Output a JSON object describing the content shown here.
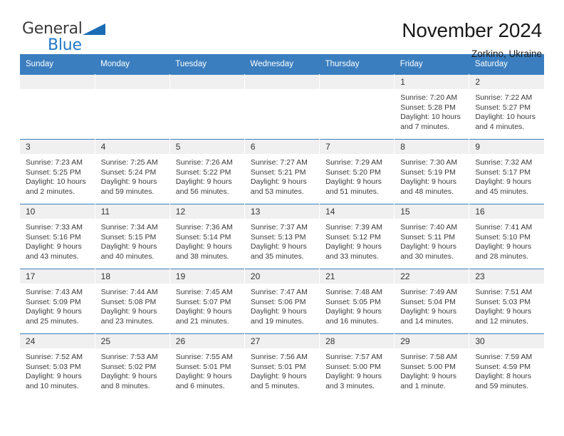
{
  "brand": {
    "name_part1": "General",
    "name_part2": "Blue",
    "triangle_color": "#1b6cb5",
    "blue": "#2079c8"
  },
  "header": {
    "title": "November 2024",
    "subtitle": "Zorkino, Ukraine"
  },
  "theme": {
    "header_bar": "#3a7ebf",
    "daynum_band": "#f0f0f0",
    "text": "#3b3b3b"
  },
  "weekday_headers": [
    "Sunday",
    "Monday",
    "Tuesday",
    "Wednesday",
    "Thursday",
    "Friday",
    "Saturday"
  ],
  "weeks": [
    [
      {
        "day": "",
        "sunrise": "",
        "sunset": "",
        "daylight1": "",
        "daylight2": ""
      },
      {
        "day": "",
        "sunrise": "",
        "sunset": "",
        "daylight1": "",
        "daylight2": ""
      },
      {
        "day": "",
        "sunrise": "",
        "sunset": "",
        "daylight1": "",
        "daylight2": ""
      },
      {
        "day": "",
        "sunrise": "",
        "sunset": "",
        "daylight1": "",
        "daylight2": ""
      },
      {
        "day": "",
        "sunrise": "",
        "sunset": "",
        "daylight1": "",
        "daylight2": ""
      },
      {
        "day": "1",
        "sunrise": "Sunrise: 7:20 AM",
        "sunset": "Sunset: 5:28 PM",
        "daylight1": "Daylight: 10 hours",
        "daylight2": "and 7 minutes."
      },
      {
        "day": "2",
        "sunrise": "Sunrise: 7:22 AM",
        "sunset": "Sunset: 5:27 PM",
        "daylight1": "Daylight: 10 hours",
        "daylight2": "and 4 minutes."
      }
    ],
    [
      {
        "day": "3",
        "sunrise": "Sunrise: 7:23 AM",
        "sunset": "Sunset: 5:25 PM",
        "daylight1": "Daylight: 10 hours",
        "daylight2": "and 2 minutes."
      },
      {
        "day": "4",
        "sunrise": "Sunrise: 7:25 AM",
        "sunset": "Sunset: 5:24 PM",
        "daylight1": "Daylight: 9 hours",
        "daylight2": "and 59 minutes."
      },
      {
        "day": "5",
        "sunrise": "Sunrise: 7:26 AM",
        "sunset": "Sunset: 5:22 PM",
        "daylight1": "Daylight: 9 hours",
        "daylight2": "and 56 minutes."
      },
      {
        "day": "6",
        "sunrise": "Sunrise: 7:27 AM",
        "sunset": "Sunset: 5:21 PM",
        "daylight1": "Daylight: 9 hours",
        "daylight2": "and 53 minutes."
      },
      {
        "day": "7",
        "sunrise": "Sunrise: 7:29 AM",
        "sunset": "Sunset: 5:20 PM",
        "daylight1": "Daylight: 9 hours",
        "daylight2": "and 51 minutes."
      },
      {
        "day": "8",
        "sunrise": "Sunrise: 7:30 AM",
        "sunset": "Sunset: 5:19 PM",
        "daylight1": "Daylight: 9 hours",
        "daylight2": "and 48 minutes."
      },
      {
        "day": "9",
        "sunrise": "Sunrise: 7:32 AM",
        "sunset": "Sunset: 5:17 PM",
        "daylight1": "Daylight: 9 hours",
        "daylight2": "and 45 minutes."
      }
    ],
    [
      {
        "day": "10",
        "sunrise": "Sunrise: 7:33 AM",
        "sunset": "Sunset: 5:16 PM",
        "daylight1": "Daylight: 9 hours",
        "daylight2": "and 43 minutes."
      },
      {
        "day": "11",
        "sunrise": "Sunrise: 7:34 AM",
        "sunset": "Sunset: 5:15 PM",
        "daylight1": "Daylight: 9 hours",
        "daylight2": "and 40 minutes."
      },
      {
        "day": "12",
        "sunrise": "Sunrise: 7:36 AM",
        "sunset": "Sunset: 5:14 PM",
        "daylight1": "Daylight: 9 hours",
        "daylight2": "and 38 minutes."
      },
      {
        "day": "13",
        "sunrise": "Sunrise: 7:37 AM",
        "sunset": "Sunset: 5:13 PM",
        "daylight1": "Daylight: 9 hours",
        "daylight2": "and 35 minutes."
      },
      {
        "day": "14",
        "sunrise": "Sunrise: 7:39 AM",
        "sunset": "Sunset: 5:12 PM",
        "daylight1": "Daylight: 9 hours",
        "daylight2": "and 33 minutes."
      },
      {
        "day": "15",
        "sunrise": "Sunrise: 7:40 AM",
        "sunset": "Sunset: 5:11 PM",
        "daylight1": "Daylight: 9 hours",
        "daylight2": "and 30 minutes."
      },
      {
        "day": "16",
        "sunrise": "Sunrise: 7:41 AM",
        "sunset": "Sunset: 5:10 PM",
        "daylight1": "Daylight: 9 hours",
        "daylight2": "and 28 minutes."
      }
    ],
    [
      {
        "day": "17",
        "sunrise": "Sunrise: 7:43 AM",
        "sunset": "Sunset: 5:09 PM",
        "daylight1": "Daylight: 9 hours",
        "daylight2": "and 25 minutes."
      },
      {
        "day": "18",
        "sunrise": "Sunrise: 7:44 AM",
        "sunset": "Sunset: 5:08 PM",
        "daylight1": "Daylight: 9 hours",
        "daylight2": "and 23 minutes."
      },
      {
        "day": "19",
        "sunrise": "Sunrise: 7:45 AM",
        "sunset": "Sunset: 5:07 PM",
        "daylight1": "Daylight: 9 hours",
        "daylight2": "and 21 minutes."
      },
      {
        "day": "20",
        "sunrise": "Sunrise: 7:47 AM",
        "sunset": "Sunset: 5:06 PM",
        "daylight1": "Daylight: 9 hours",
        "daylight2": "and 19 minutes."
      },
      {
        "day": "21",
        "sunrise": "Sunrise: 7:48 AM",
        "sunset": "Sunset: 5:05 PM",
        "daylight1": "Daylight: 9 hours",
        "daylight2": "and 16 minutes."
      },
      {
        "day": "22",
        "sunrise": "Sunrise: 7:49 AM",
        "sunset": "Sunset: 5:04 PM",
        "daylight1": "Daylight: 9 hours",
        "daylight2": "and 14 minutes."
      },
      {
        "day": "23",
        "sunrise": "Sunrise: 7:51 AM",
        "sunset": "Sunset: 5:03 PM",
        "daylight1": "Daylight: 9 hours",
        "daylight2": "and 12 minutes."
      }
    ],
    [
      {
        "day": "24",
        "sunrise": "Sunrise: 7:52 AM",
        "sunset": "Sunset: 5:03 PM",
        "daylight1": "Daylight: 9 hours",
        "daylight2": "and 10 minutes."
      },
      {
        "day": "25",
        "sunrise": "Sunrise: 7:53 AM",
        "sunset": "Sunset: 5:02 PM",
        "daylight1": "Daylight: 9 hours",
        "daylight2": "and 8 minutes."
      },
      {
        "day": "26",
        "sunrise": "Sunrise: 7:55 AM",
        "sunset": "Sunset: 5:01 PM",
        "daylight1": "Daylight: 9 hours",
        "daylight2": "and 6 minutes."
      },
      {
        "day": "27",
        "sunrise": "Sunrise: 7:56 AM",
        "sunset": "Sunset: 5:01 PM",
        "daylight1": "Daylight: 9 hours",
        "daylight2": "and 5 minutes."
      },
      {
        "day": "28",
        "sunrise": "Sunrise: 7:57 AM",
        "sunset": "Sunset: 5:00 PM",
        "daylight1": "Daylight: 9 hours",
        "daylight2": "and 3 minutes."
      },
      {
        "day": "29",
        "sunrise": "Sunrise: 7:58 AM",
        "sunset": "Sunset: 5:00 PM",
        "daylight1": "Daylight: 9 hours",
        "daylight2": "and 1 minute."
      },
      {
        "day": "30",
        "sunrise": "Sunrise: 7:59 AM",
        "sunset": "Sunset: 4:59 PM",
        "daylight1": "Daylight: 8 hours",
        "daylight2": "and 59 minutes."
      }
    ]
  ]
}
